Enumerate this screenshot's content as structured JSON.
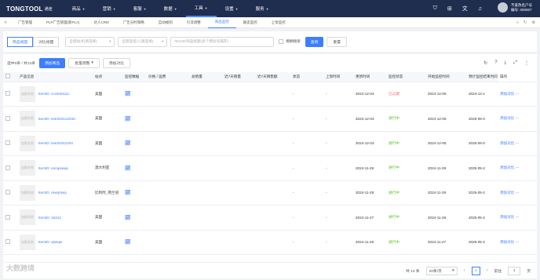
{
  "brand": {
    "logo": "TONGTOOL",
    "sub": "通途"
  },
  "topmenu": [
    {
      "label": "商品",
      "active": false
    },
    {
      "label": "营销",
      "active": false
    },
    {
      "label": "客服",
      "active": false
    },
    {
      "label": "数据",
      "active": false
    },
    {
      "label": "工具",
      "active": true
    },
    {
      "label": "设置",
      "active": false
    },
    {
      "label": "服务",
      "active": false
    }
  ],
  "user": {
    "name": "不爱改名户号",
    "id": "编号: 000007"
  },
  "tabs": [
    "广告管理",
    "PLP广告管理(新PLA)",
    "达人CRM",
    "广告分时策略",
    "自动规则",
    "引流调整",
    "商品监控",
    "跟卖监控",
    "上架监控"
  ],
  "active_tab": "商品监控",
  "filters": {
    "seg_left": "商品视图",
    "seg_right": "对比视图",
    "select_all_shops": "全部站点(请选择)",
    "select_all_users": "全部监控人(请选择)",
    "search_placeholder": "ItemID/商品标题(多个用逗号隔开)",
    "fuzzy_label": "模糊搜索",
    "query_btn": "查询",
    "reset_btn": "重置"
  },
  "toolbar": {
    "selected_count": "选中0条 / 共13条",
    "add_btn": "添加商品",
    "batch_btn": "批量调整",
    "compare_btn": "添加对比"
  },
  "columns": [
    "产品信息",
    "站点",
    "监控数据",
    "价格 / 运费",
    "总销量",
    "近7天销量",
    "近7天销售额",
    "状态",
    "上架时间",
    "更新时间",
    "监控状态",
    "开始监控时间",
    "预计监控结束时间",
    "操作"
  ],
  "rows": [
    {
      "thumb": "加载失败",
      "item_id": "ItemID: ccctest111c",
      "site": "美国",
      "status_text": "-",
      "update": "2024-12-04",
      "monitor": "已过期",
      "monitor_color": "red",
      "start": "2024-12-05",
      "end": "2024-12-1",
      "op": "添加对比"
    },
    {
      "thumb": "加载失败",
      "item_id": "ItemID: test20241204Ic",
      "site": "美国",
      "status_text": "-",
      "update": "2024-12-04",
      "monitor": "进行中",
      "monitor_color": "green",
      "start": "2024-12-05",
      "end": "2025-06-0",
      "op": "添加对比"
    },
    {
      "thumb": "加载失败",
      "item_id": "ItemID: test20241204",
      "site": "美国",
      "status_text": "-",
      "update": "2024-12-04",
      "monitor": "进行中",
      "monitor_color": "green",
      "start": "2024-12-05",
      "end": "2025-06-0",
      "op": "添加对比"
    },
    {
      "thumb": "加载失败",
      "item_id": "ItemID: eonqwwqe",
      "site": "澳大利亚",
      "status_text": "-",
      "update": "2024-11-28",
      "monitor": "进行中",
      "monitor_color": "green",
      "start": "2024-11-29",
      "end": "2025-05-2",
      "op": "添加对比"
    },
    {
      "thumb": "加载失败",
      "item_id": "ItemID: rewqrswq",
      "site": "比利时_荷兰语",
      "status_text": "-",
      "update": "2024-11-28",
      "monitor": "进行中",
      "monitor_color": "green",
      "start": "2024-11-29",
      "end": "2025-05-2",
      "op": "添加对比"
    },
    {
      "thumb": "加载失败",
      "item_id": "ItemID: 34212",
      "site": "美国",
      "status_text": "-",
      "update": "2024-11-27",
      "monitor": "进行中",
      "monitor_color": "green",
      "start": "2024-11-28",
      "end": "2025-05-2",
      "op": "添加对比"
    },
    {
      "thumb": "加载失败",
      "item_id": "ItemID: qswqw",
      "site": "美国",
      "status_text": "-",
      "update": "2024-11-26",
      "monitor": "进行中",
      "monitor_color": "green",
      "start": "2024-11-27",
      "end": "2025-05-2",
      "op": "添加对比"
    }
  ],
  "pagination": {
    "total": "共 13 条",
    "page_size": "20条/页",
    "prev": "前往",
    "current": "1",
    "goto_value": "1",
    "goto_suffix": "页"
  },
  "watermark": "大数跨境"
}
